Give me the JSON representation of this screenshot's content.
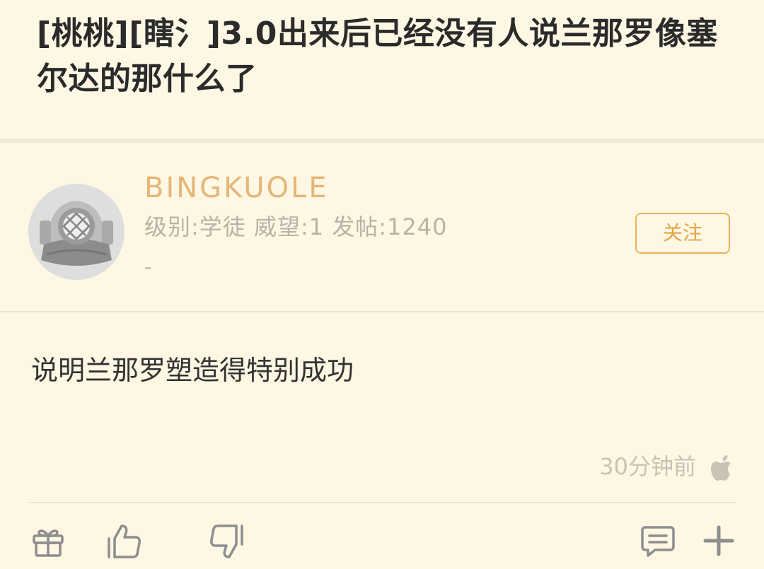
{
  "post": {
    "title": "[桃桃][瞎氵]3.0出来后已经没有人说兰那罗像塞尔达的那什么了",
    "author": {
      "username": "BINGKUOLE",
      "meta": "级别:学徒 威望:1 发帖:1240",
      "signature": "-",
      "follow_label": "关注"
    },
    "body": "说明兰那罗塑造得特别成功",
    "time": "30分钟前",
    "device_icon": "apple-icon"
  },
  "actions": {
    "gift_icon": "gift-icon",
    "like_icon": "thumbs-up-icon",
    "dislike_icon": "thumbs-down-icon",
    "comment_icon": "comment-icon",
    "more_icon": "plus-icon"
  },
  "colors": {
    "background": "#fdf7e4",
    "username": "#e5b678",
    "follow_accent": "#eab15a",
    "muted_text": "#b9b3a6"
  }
}
